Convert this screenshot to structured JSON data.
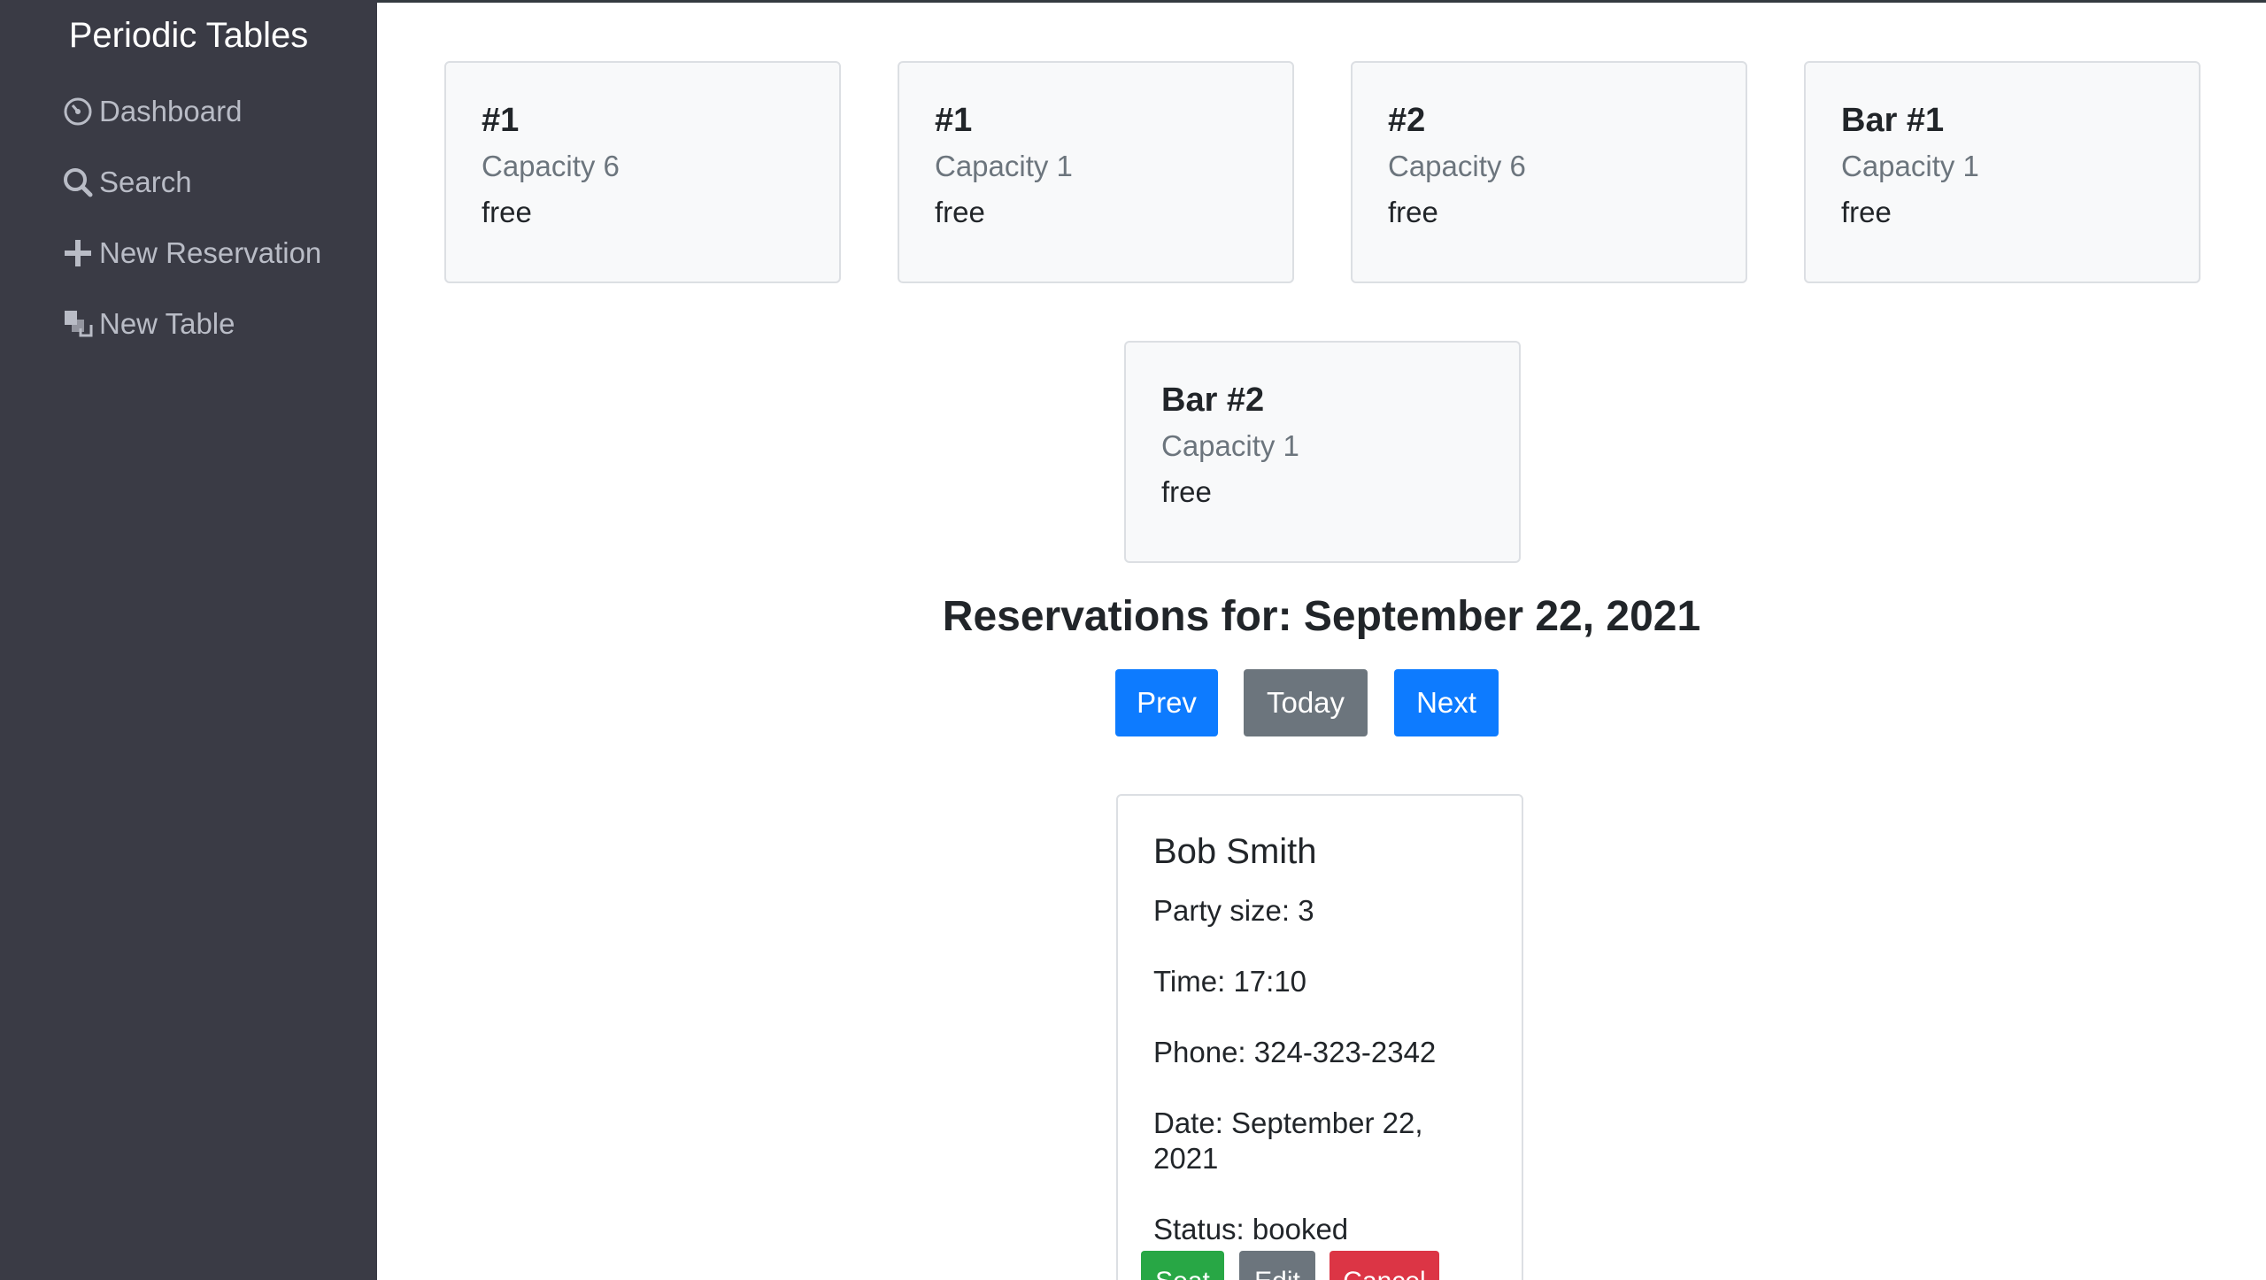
{
  "sidebar": {
    "brand": "Periodic Tables",
    "items": [
      {
        "label": "Dashboard",
        "icon": "dashboard-icon"
      },
      {
        "label": "Search",
        "icon": "search-icon"
      },
      {
        "label": "New Reservation",
        "icon": "plus-icon"
      },
      {
        "label": "New Table",
        "icon": "layers-icon"
      }
    ]
  },
  "tables": [
    {
      "name": "#1",
      "capacity": "Capacity 6",
      "status": "free"
    },
    {
      "name": "#1",
      "capacity": "Capacity 1",
      "status": "free"
    },
    {
      "name": "#2",
      "capacity": "Capacity 6",
      "status": "free"
    },
    {
      "name": "Bar #1",
      "capacity": "Capacity 1",
      "status": "free"
    },
    {
      "name": "Bar #2",
      "capacity": "Capacity 1",
      "status": "free"
    }
  ],
  "reservations_heading": "Reservations for: September 22, 2021",
  "date_nav": {
    "prev": "Prev",
    "today": "Today",
    "next": "Next"
  },
  "reservation": {
    "name": "Bob Smith",
    "party_size": "Party size: 3",
    "time": "Time: 17:10",
    "phone": "Phone: 324-323-2342",
    "date": "Date: September 22, 2021",
    "status": "Status: booked",
    "actions": {
      "seat": "Seat",
      "edit": "Edit",
      "cancel": "Cancel"
    }
  },
  "colors": {
    "sidebar_bg": "#3a3b45",
    "primary": "#0d7bff",
    "secondary": "#6c757d",
    "success": "#28a745",
    "danger": "#dc3545"
  }
}
